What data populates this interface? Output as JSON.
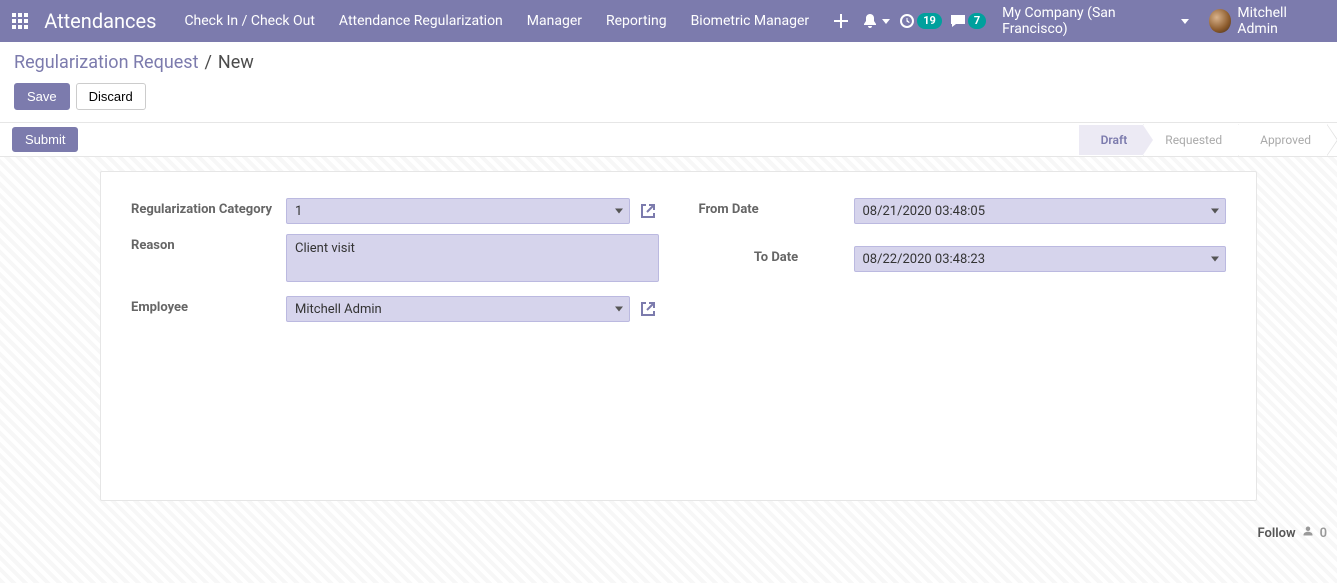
{
  "header": {
    "app_title": "Attendances",
    "menu": {
      "check": "Check In / Check Out",
      "reg": "Attendance Regularization",
      "manager": "Manager",
      "reporting": "Reporting",
      "bio": "Biometric Manager"
    },
    "badges": {
      "activities": "19",
      "messages": "7"
    },
    "company": "My Company (San Francisco)",
    "user": "Mitchell Admin"
  },
  "breadcrumb": {
    "parent": "Regularization Request",
    "sep": "/",
    "current": "New"
  },
  "actions": {
    "save": "Save",
    "discard": "Discard",
    "submit": "Submit"
  },
  "stages": {
    "s1": "Draft",
    "s2": "Requested",
    "s3": "Approved"
  },
  "form": {
    "labels": {
      "reg_cat": "Regularization Category",
      "reason": "Reason",
      "employee": "Employee",
      "from_date": "From Date",
      "to_date": "To Date"
    },
    "values": {
      "reg_cat": "1",
      "reason": "Client visit",
      "employee": "Mitchell Admin",
      "from_date": "08/21/2020 03:48:05",
      "to_date": "08/22/2020 03:48:23"
    }
  },
  "footer": {
    "follow": "Follow",
    "followers": "0"
  }
}
